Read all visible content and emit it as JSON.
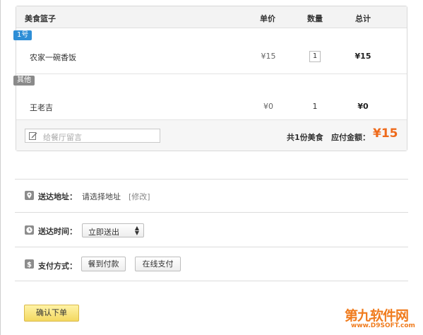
{
  "basket": {
    "title": "美食篮子",
    "col_price": "单价",
    "col_qty": "数量",
    "col_total": "总计",
    "groups": [
      {
        "tag": "1号",
        "tag_color": "#2e8ed6",
        "item": {
          "name": "农家一碗香饭",
          "price": "¥15",
          "qty": "1",
          "total": "¥15"
        }
      },
      {
        "tag": "其他",
        "tag_color": "#8a8a8a",
        "item": {
          "name": "王老吉",
          "price": "¥0",
          "qty": "1",
          "total": "¥0"
        }
      }
    ],
    "memo_placeholder": "给餐厅留言",
    "summary_count": "共1份美食",
    "summary_label": "应付金额：",
    "summary_amount": "¥15",
    "amount_color": "#ee6a1b"
  },
  "address": {
    "label": "送达地址：",
    "value": "请选择地址",
    "edit": "[修改]",
    "icon": "location-pin-icon"
  },
  "time": {
    "label": "送达时间：",
    "selected": "立即送出",
    "icon": "clock-icon"
  },
  "payment": {
    "label": "支付方式：",
    "options": [
      "餐到付款",
      "在线支付"
    ],
    "icon": "dollar-icon"
  },
  "confirm_label": "确认下单",
  "watermark": {
    "main": "第九软件网",
    "sub": "www.D9SOFT.com"
  }
}
